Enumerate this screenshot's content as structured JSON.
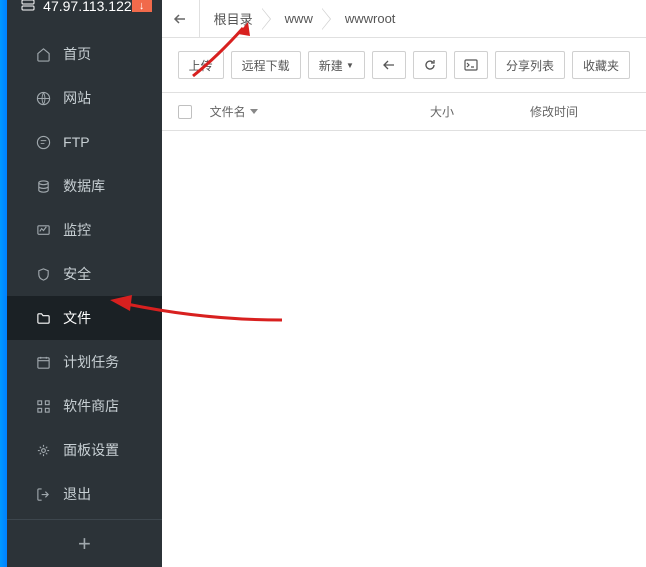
{
  "header": {
    "ip": "47.97.113.122",
    "badge": "↓"
  },
  "sidebar": {
    "items": [
      {
        "label": "首页",
        "icon": "home"
      },
      {
        "label": "网站",
        "icon": "globe"
      },
      {
        "label": "FTP",
        "icon": "ftp"
      },
      {
        "label": "数据库",
        "icon": "database"
      },
      {
        "label": "监控",
        "icon": "monitor"
      },
      {
        "label": "安全",
        "icon": "shield"
      },
      {
        "label": "文件",
        "icon": "folder",
        "active": true
      },
      {
        "label": "计划任务",
        "icon": "calendar"
      },
      {
        "label": "软件商店",
        "icon": "apps"
      },
      {
        "label": "面板设置",
        "icon": "gear"
      },
      {
        "label": "退出",
        "icon": "logout"
      }
    ]
  },
  "breadcrumb": {
    "segments": [
      "根目录",
      "www",
      "wwwroot"
    ]
  },
  "toolbar": {
    "upload": "上传",
    "remote": "远程下载",
    "create": "新建",
    "share": "分享列表",
    "favorites": "收藏夹"
  },
  "table": {
    "headers": {
      "name": "文件名",
      "size": "大小",
      "time": "修改时间"
    }
  }
}
